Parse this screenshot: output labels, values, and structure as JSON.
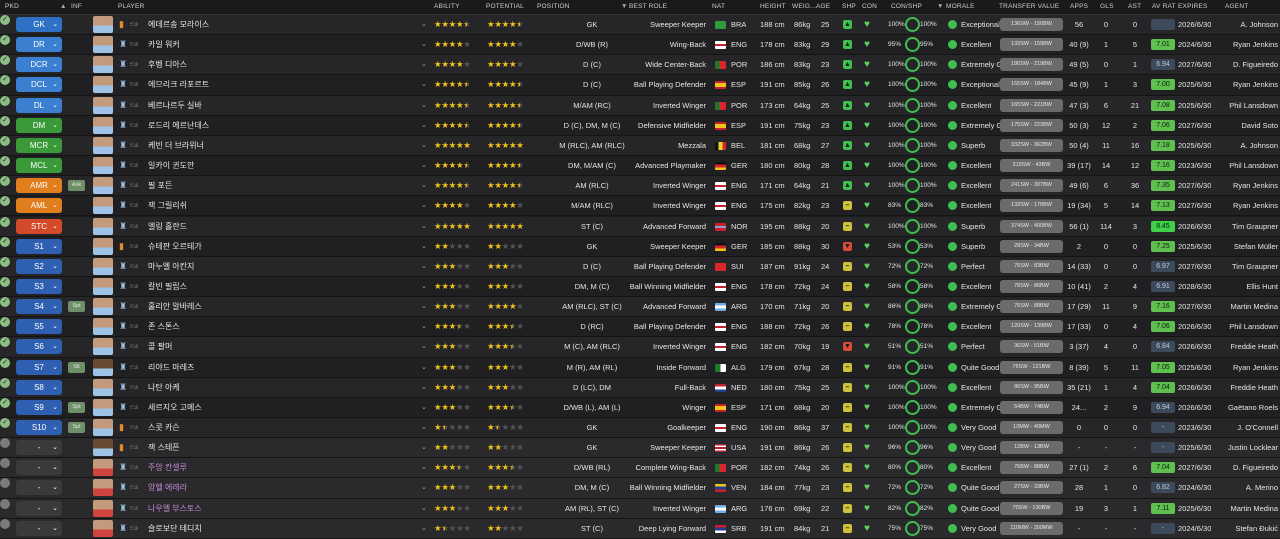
{
  "columns": {
    "pkd": "PKD",
    "inf": "INF",
    "player": "PLAYER",
    "ability": "ABILITY",
    "potential": "POTENTIAL",
    "position": "POSITION",
    "best_role": "BEST ROLE",
    "nat": "NAT",
    "height": "HEIGHT",
    "weight": "WEIG...",
    "age": "AGE",
    "shp": "SHP",
    "con": "CON",
    "con_shp": "CON/SHP",
    "morale": "MORALE",
    "transfer_value": "TRANSFER VALUE",
    "apps": "APPS",
    "gls": "GLS",
    "ast": "AST",
    "av_rat": "AV RAT",
    "expires": "EXPIRES",
    "agent": "AGENT"
  },
  "colors": {
    "gk": "#2f72c5",
    "def": "#3a7fd0",
    "mid": "#3a9a3a",
    "att": "#e07d1c",
    "st": "#d24a2a",
    "sub": "#2f5fb0",
    "res": "#3a3a3c"
  },
  "players": [
    {
      "slot": "GK",
      "group": "gk",
      "inf": "",
      "name": "에데르송 모라이스",
      "loan": false,
      "ability": "4.5",
      "potential": "4.5",
      "position": "GK",
      "role": "Sweeper Keeper",
      "flag": "bra",
      "nat": "BRA",
      "height": "188 cm",
      "weight": "86kg",
      "age": "25",
      "shp": "up",
      "con": "100%",
      "morale": "Exceptional",
      "tv": "136SW - 150BW",
      "apps": "56",
      "gls": "0",
      "ast": "0",
      "rat": "",
      "expires": "2026/6/30",
      "agent": "A. Johnson"
    },
    {
      "slot": "DR",
      "group": "def",
      "inf": "",
      "name": "카일 워커",
      "loan": false,
      "ability": "4",
      "potential": "4",
      "position": "D/WB (R)",
      "role": "Wing-Back",
      "flag": "eng",
      "nat": "ENG",
      "height": "178 cm",
      "weight": "83kg",
      "age": "29",
      "shp": "up",
      "con": "95%",
      "morale": "Excellent",
      "tv": "133SW - 159BW",
      "apps": "40 (9)",
      "gls": "1",
      "ast": "5",
      "rat": "7.01",
      "expires": "2024/6/30",
      "agent": "Ryan Jenkins"
    },
    {
      "slot": "DCR",
      "group": "def",
      "inf": "",
      "name": "후벵 디아스",
      "loan": false,
      "ability": "4",
      "potential": "4",
      "position": "D (C)",
      "role": "Wide Center-Back",
      "flag": "por",
      "nat": "POR",
      "height": "186 cm",
      "weight": "83kg",
      "age": "23",
      "shp": "up",
      "con": "100%",
      "morale": "Extremely Good",
      "tv": "180SW - 219BW",
      "apps": "49 (5)",
      "gls": "0",
      "ast": "1",
      "rat": "6.94",
      "expires": "2027/6/30",
      "agent": "D. Figueiredo"
    },
    {
      "slot": "DCL",
      "group": "def",
      "inf": "",
      "name": "에므리크 라포르트",
      "loan": false,
      "ability": "4.5",
      "potential": "4.5",
      "position": "D (C)",
      "role": "Ball Playing Defender",
      "flag": "esp",
      "nat": "ESP",
      "height": "191 cm",
      "weight": "85kg",
      "age": "26",
      "shp": "up",
      "con": "100%",
      "morale": "Exceptional",
      "tv": "155SW - 184BW",
      "apps": "45 (9)",
      "gls": "1",
      "ast": "3",
      "rat": "7.00",
      "expires": "2025/6/30",
      "agent": "Ryan Jenkins"
    },
    {
      "slot": "DL",
      "group": "def",
      "inf": "",
      "name": "베르나르두 실바",
      "loan": false,
      "ability": "4.5",
      "potential": "4.5",
      "position": "M/AM (RC)",
      "role": "Inverted Winger",
      "flag": "por",
      "nat": "POR",
      "height": "173 cm",
      "weight": "64kg",
      "age": "25",
      "shp": "up",
      "con": "100%",
      "morale": "Excellent",
      "tv": "165SW - 221BW",
      "apps": "47 (3)",
      "gls": "6",
      "ast": "21",
      "rat": "7.08",
      "expires": "2025/6/30",
      "agent": "Phil Lansdown"
    },
    {
      "slot": "DM",
      "group": "mid",
      "inf": "",
      "name": "로드리 에르난데스",
      "loan": false,
      "ability": "4.5",
      "potential": "4.5",
      "position": "D (C), DM, M (C)",
      "role": "Defensive Midfielder",
      "flag": "esp",
      "nat": "ESP",
      "height": "191 cm",
      "weight": "75kg",
      "age": "23",
      "shp": "up",
      "con": "100%",
      "morale": "Extremely Good",
      "tv": "175SW - 223BW",
      "apps": "50 (3)",
      "gls": "12",
      "ast": "2",
      "rat": "7.06",
      "expires": "2027/6/30",
      "agent": "David Soto"
    },
    {
      "slot": "MCR",
      "group": "mid",
      "inf": "",
      "name": "케빈 더 브라위너",
      "loan": false,
      "ability": "5",
      "potential": "5",
      "position": "M (RLC), AM (RLC)",
      "role": "Mezzala",
      "flag": "bel",
      "nat": "BEL",
      "height": "181 cm",
      "weight": "68kg",
      "age": "27",
      "shp": "up",
      "con": "100%",
      "morale": "Superb",
      "tv": "332SW - 362BW",
      "apps": "50 (4)",
      "gls": "11",
      "ast": "16",
      "rat": "7.18",
      "expires": "2025/6/30",
      "agent": "A. Johnson"
    },
    {
      "slot": "MCL",
      "group": "mid",
      "inf": "",
      "name": "일카이 귄도안",
      "loan": false,
      "ability": "4.5",
      "potential": "4.5",
      "position": "DM, M/AM (C)",
      "role": "Advanced Playmaker",
      "flag": "ger",
      "nat": "GER",
      "height": "180 cm",
      "weight": "80kg",
      "age": "28",
      "shp": "up",
      "con": "100%",
      "morale": "Excellent",
      "tv": "319SW - 43BW",
      "apps": "39 (17)",
      "gls": "14",
      "ast": "12",
      "rat": "7.16",
      "expires": "2023/6/30",
      "agent": "Phil Lansdown"
    },
    {
      "slot": "AMR",
      "group": "att",
      "inf": "Ask",
      "name": "필 포든",
      "loan": false,
      "ability": "4.5",
      "potential": "4.5",
      "position": "AM (RLC)",
      "role": "Inverted Winger",
      "flag": "eng",
      "nat": "ENG",
      "height": "171 cm",
      "weight": "64kg",
      "age": "21",
      "shp": "up",
      "con": "100%",
      "morale": "Excellent",
      "tv": "241SW - 307BW",
      "apps": "49 (6)",
      "gls": "6",
      "ast": "36",
      "rat": "7.35",
      "expires": "2027/6/30",
      "agent": "Ryan Jenkins"
    },
    {
      "slot": "AML",
      "group": "att",
      "inf": "",
      "name": "잭 그릴리쉬",
      "loan": false,
      "ability": "4",
      "potential": "4",
      "position": "M/AM (RLC)",
      "role": "Inverted Winger",
      "flag": "eng",
      "nat": "ENG",
      "height": "175 cm",
      "weight": "82kg",
      "age": "23",
      "shp": "ok",
      "con": "83%",
      "morale": "Excellent",
      "tv": "133SW - 178BW",
      "apps": "19 (34)",
      "gls": "5",
      "ast": "14",
      "rat": "7.13",
      "expires": "2027/6/30",
      "agent": "Ryan Jenkins"
    },
    {
      "slot": "STC",
      "group": "st",
      "inf": "",
      "name": "엘링 홀란드",
      "loan": false,
      "ability": "5",
      "potential": "5",
      "position": "ST (C)",
      "role": "Advanced Forward",
      "flag": "nor",
      "nat": "NOR",
      "height": "195 cm",
      "weight": "88kg",
      "age": "20",
      "shp": "ok",
      "con": "100%",
      "morale": "Superb",
      "tv": "374SW - 400BW",
      "apps": "56 (1)",
      "gls": "114",
      "ast": "3",
      "rat": "8.45",
      "expires": "2026/6/30",
      "agent": "Tim Graupner"
    },
    {
      "slot": "S1",
      "group": "sub",
      "inf": "",
      "name": "슈테판 오르테가",
      "loan": false,
      "ability": "2",
      "potential": "2",
      "position": "GK",
      "role": "Sweeper Keeper",
      "flag": "ger",
      "nat": "GER",
      "height": "185 cm",
      "weight": "88kg",
      "age": "30",
      "shp": "down",
      "con": "53%",
      "morale": "Superb",
      "tv": "28SW - 34BW",
      "apps": "2",
      "gls": "0",
      "ast": "0",
      "rat": "7.25",
      "expires": "2025/6/30",
      "agent": "Stefan Müller"
    },
    {
      "slot": "S2",
      "group": "sub",
      "inf": "",
      "name": "마누엘 아칸지",
      "loan": false,
      "ability": "3",
      "potential": "3",
      "position": "D (C)",
      "role": "Ball Playing Defender",
      "flag": "sui",
      "nat": "SUI",
      "height": "187 cm",
      "weight": "91kg",
      "age": "24",
      "shp": "ok",
      "con": "72%",
      "morale": "Perfect",
      "tv": "76SW - 83BW",
      "apps": "14 (33)",
      "gls": "0",
      "ast": "0",
      "rat": "6.97",
      "expires": "2027/6/30",
      "agent": "Tim Graupner"
    },
    {
      "slot": "S3",
      "group": "sub",
      "inf": "",
      "name": "칼빈 필립스",
      "loan": false,
      "ability": "3",
      "potential": "3",
      "position": "DM, M (C)",
      "role": "Ball Winning Midfielder",
      "flag": "eng",
      "nat": "ENG",
      "height": "178 cm",
      "weight": "72kg",
      "age": "24",
      "shp": "ok",
      "con": "58%",
      "morale": "Excellent",
      "tv": "78SW - 86BW",
      "apps": "10 (41)",
      "gls": "2",
      "ast": "4",
      "rat": "6.91",
      "expires": "2028/6/30",
      "agent": "Ellis Hunt"
    },
    {
      "slot": "S4",
      "group": "sub",
      "inf": "Spt",
      "name": "훌리안 알바레스",
      "loan": false,
      "ability": "3",
      "potential": "4",
      "position": "AM (RLC), ST (C)",
      "role": "Advanced Forward",
      "flag": "arg",
      "nat": "ARG",
      "height": "170 cm",
      "weight": "71kg",
      "age": "20",
      "shp": "ok",
      "con": "86%",
      "morale": "Extremely Good",
      "tv": "76SW - 88BW",
      "apps": "17 (29)",
      "gls": "11",
      "ast": "9",
      "rat": "7.16",
      "expires": "2027/6/30",
      "agent": "Martin Medina"
    },
    {
      "slot": "S5",
      "group": "sub",
      "inf": "",
      "name": "존 스톤스",
      "loan": false,
      "ability": "3.5",
      "potential": "3.5",
      "position": "D (RC)",
      "role": "Ball Playing Defender",
      "flag": "eng",
      "nat": "ENG",
      "height": "188 cm",
      "weight": "72kg",
      "age": "26",
      "shp": "ok",
      "con": "78%",
      "morale": "Excellent",
      "tv": "120SW - 139BW",
      "apps": "17 (33)",
      "gls": "0",
      "ast": "4",
      "rat": "7.06",
      "expires": "2026/6/30",
      "agent": "Phil Lansdown"
    },
    {
      "slot": "S6",
      "group": "sub",
      "inf": "",
      "name": "콜 팔머",
      "loan": false,
      "ability": "3",
      "potential": "3.5",
      "position": "M (C), AM (RLC)",
      "role": "Inverted Winger",
      "flag": "eng",
      "nat": "ENG",
      "height": "182 cm",
      "weight": "70kg",
      "age": "19",
      "shp": "down",
      "con": "51%",
      "morale": "Perfect",
      "tv": "36SW - 51BW",
      "apps": "3 (37)",
      "gls": "4",
      "ast": "0",
      "rat": "6.84",
      "expires": "2026/6/30",
      "agent": "Freddie Heath"
    },
    {
      "slot": "S7",
      "group": "sub",
      "inf": "Slt",
      "name": "리야드 마레즈",
      "loan": false,
      "ability": "3",
      "potential": "3",
      "position": "M (R), AM (RL)",
      "role": "Inside Forward",
      "flag": "alg",
      "nat": "ALG",
      "height": "179 cm",
      "weight": "67kg",
      "age": "28",
      "shp": "ok",
      "con": "91%",
      "morale": "Quite Good",
      "tv": "76SW - 121BW",
      "apps": "8 (39)",
      "gls": "5",
      "ast": "11",
      "rat": "7.05",
      "expires": "2025/6/30",
      "agent": "Ryan Jenkins"
    },
    {
      "slot": "S8",
      "group": "sub",
      "inf": "",
      "name": "나탄 아케",
      "loan": false,
      "ability": "3",
      "potential": "3",
      "position": "D (LC), DM",
      "role": "Full-Back",
      "flag": "ned",
      "nat": "NED",
      "height": "180 cm",
      "weight": "75kg",
      "age": "25",
      "shp": "ok",
      "con": "100%",
      "morale": "Excellent",
      "tv": "86SW - 95BW",
      "apps": "35 (21)",
      "gls": "1",
      "ast": "4",
      "rat": "7.04",
      "expires": "2026/6/30",
      "agent": "Freddie Heath"
    },
    {
      "slot": "S9",
      "group": "sub",
      "inf": "Spt",
      "name": "세르지오 고메스",
      "loan": false,
      "ability": "3",
      "potential": "3.5",
      "position": "D/WB (L), AM (L)",
      "role": "Winger",
      "flag": "esp",
      "nat": "ESP",
      "height": "171 cm",
      "weight": "68kg",
      "age": "20",
      "shp": "ok",
      "con": "100%",
      "morale": "Extremely Good",
      "tv": "54BW - 74BW",
      "apps": "24...",
      "gls": "2",
      "ast": "9",
      "rat": "6.94",
      "expires": "2026/6/30",
      "agent": "Gaëtano Roels"
    },
    {
      "slot": "S10",
      "group": "sub",
      "inf": "Spt",
      "name": "스콧 카슨",
      "loan": false,
      "ability": "1.5",
      "potential": "1.5",
      "position": "GK",
      "role": "Goalkeeper",
      "flag": "eng",
      "nat": "ENG",
      "height": "190 cm",
      "weight": "86kg",
      "age": "37",
      "shp": "ok",
      "con": "100%",
      "morale": "Very Good",
      "tv": "10MW - 40MW",
      "apps": "0",
      "gls": "0",
      "ast": "0",
      "rat": "-",
      "expires": "2023/6/30",
      "agent": "J. O'Connell"
    },
    {
      "slot": "-",
      "group": "res",
      "inf": "",
      "name": "잭 스테픈",
      "loan": false,
      "ability": "2",
      "potential": "2",
      "position": "GK",
      "role": "Sweeper Keeper",
      "flag": "usa",
      "nat": "USA",
      "height": "191 cm",
      "weight": "86kg",
      "age": "26",
      "shp": "ok",
      "con": "96%",
      "morale": "Very Good",
      "tv": "12BW - 13BW",
      "apps": "-",
      "gls": "-",
      "ast": "-",
      "rat": "-",
      "expires": "2025/6/30",
      "agent": "Justin Locklear"
    },
    {
      "slot": "-",
      "group": "res",
      "inf": "",
      "name": "주앙 칸셀루",
      "loan": true,
      "ability": "3.5",
      "potential": "3.5",
      "position": "D/WB (RL)",
      "role": "Complete Wing-Back",
      "flag": "por",
      "nat": "POR",
      "height": "182 cm",
      "weight": "74kg",
      "age": "26",
      "shp": "ok",
      "con": "80%",
      "morale": "Excellent",
      "tv": "76BW - 88BW",
      "apps": "27 (1)",
      "gls": "2",
      "ast": "6",
      "rat": "7.04",
      "expires": "2027/6/30",
      "agent": "D. Figueiredo"
    },
    {
      "slot": "-",
      "group": "res",
      "inf": "",
      "name": "양헬 에레라",
      "loan": true,
      "ability": "3",
      "potential": "3",
      "position": "DM, M (C)",
      "role": "Ball Winning Midfielder",
      "flag": "ven",
      "nat": "VEN",
      "height": "184 cm",
      "weight": "77kg",
      "age": "23",
      "shp": "ok",
      "con": "72%",
      "morale": "Quite Good",
      "tv": "27SW - 33BW",
      "apps": "28",
      "gls": "1",
      "ast": "0",
      "rat": "6.82",
      "expires": "2024/6/30",
      "agent": "A. Merino"
    },
    {
      "slot": "-",
      "group": "res",
      "inf": "",
      "name": "나우엘 부스토스",
      "loan": true,
      "ability": "3",
      "potential": "3",
      "position": "AM (RL), ST (C)",
      "role": "Inverted Winger",
      "flag": "arg",
      "nat": "ARG",
      "height": "176 cm",
      "weight": "69kg",
      "age": "22",
      "shp": "ok",
      "con": "82%",
      "morale": "Quite Good",
      "tv": "70SW - 130BW",
      "apps": "19",
      "gls": "3",
      "ast": "1",
      "rat": "7.11",
      "expires": "2025/6/30",
      "agent": "Martin Medina"
    },
    {
      "slot": "-",
      "group": "res",
      "inf": "",
      "name": "슬로보단 테디치",
      "loan": false,
      "ability": "1.5",
      "potential": "2",
      "position": "ST (C)",
      "role": "Deep Lying Forward",
      "flag": "srb",
      "nat": "SRB",
      "height": "191 cm",
      "weight": "84kg",
      "age": "21",
      "shp": "ok",
      "con": "75%",
      "morale": "Very Good",
      "tv": "110MW - 300MW",
      "apps": "-",
      "gls": "-",
      "ast": "-",
      "rat": "-",
      "expires": "2024/6/30",
      "agent": "Stefan Đukić"
    }
  ]
}
